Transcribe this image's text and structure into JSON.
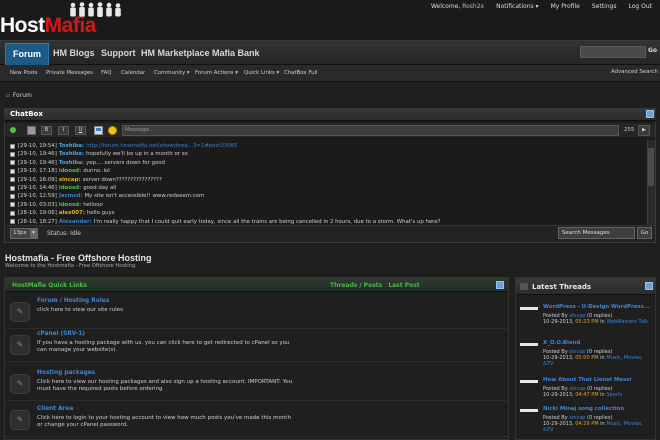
{
  "header": {
    "logo_part1": "Host",
    "logo_part2": "Mafia",
    "welcome": "Welcome,",
    "username": "Rosh2x",
    "notifications": "Notifications ▾",
    "my_profile": "My Profile",
    "settings": "Settings",
    "logout": "Log Out"
  },
  "nav": {
    "tabs": [
      "Forum",
      "HM Blogs",
      "Support",
      "HM Marketplace",
      "Mafia Bank"
    ],
    "go": "Go"
  },
  "subnav": {
    "items": [
      "New Posts",
      "Private Messages",
      "FAQ",
      "Calendar",
      "Community ▾",
      "Forum Actions ▾",
      "Quick Links ▾",
      "ChatBox Full"
    ],
    "advanced_search": "Advanced Search"
  },
  "breadcrumb": "Forum",
  "chatbox": {
    "title": "ChatBox",
    "toolbar_buttons": [
      "B",
      "I",
      "U"
    ],
    "input_placeholder": "Message...",
    "char_count": "255",
    "send": "▶",
    "messages": [
      {
        "time": "[29-10, 19:54]",
        "user": "Toshiba:",
        "user_color": "#4aa8e0",
        "text": "http://forum.hostmafia.net/showthrea...3=1#post23085",
        "link": true
      },
      {
        "time": "[29-10, 19:46]",
        "user": "Toshiba:",
        "user_color": "#4aa8e0",
        "text": "hopefully we'll be up in a month or so",
        "link": false
      },
      {
        "time": "[29-10, 19:46]",
        "user": "Toshiba:",
        "user_color": "#4aa8e0",
        "text": "yep.... servers down for good",
        "link": false
      },
      {
        "time": "[29-10, 17:18]",
        "user": "idoosd:",
        "user_color": "#4fc14f",
        "text": "dunno..lol",
        "link": false
      },
      {
        "time": "[29-10, 16:09]",
        "user": "sincap:",
        "user_color": "#e0b020",
        "text": "server down????????????????",
        "link": false
      },
      {
        "time": "[29-10, 14:46]",
        "user": "idoosd:",
        "user_color": "#4fc14f",
        "text": "good day all",
        "link": false
      },
      {
        "time": "[29-10, 12:59]",
        "user": "Jacmsd:",
        "user_color": "#3f7dc6",
        "text": "My site isn't accessible!! www.redeeem.com",
        "link": false
      },
      {
        "time": "[29-10, 03:03]",
        "user": "idoosd:",
        "user_color": "#4fc14f",
        "text": "hellooo",
        "link": false
      },
      {
        "time": "[28-10, 19:06]",
        "user": "alex007:",
        "user_color": "#e0b020",
        "text": "hello guys",
        "link": false
      },
      {
        "time": "[28-10, 18:27]",
        "user": "Alexander:",
        "user_color": "#3f7dc6",
        "text": "I'm really happy that I could quit early today, since all the trains are being cancelled in 2 hours, due to a storm. What's up here?",
        "link": false
      }
    ],
    "font_size": "13px",
    "status_label": "Status:",
    "status_value": "Idle",
    "search_messages": "Search Messages",
    "search_go": "Go"
  },
  "forum": {
    "title": "Hostmafia - Free Offshore Hosting",
    "subtitle": "Welcome to the Hostmafia - Free Offshore Hosting."
  },
  "quick_links": {
    "title": "HostMafia Quick Links",
    "col_threads": "Threads / Posts",
    "col_last": "Last Post",
    "rows": [
      {
        "name": "Forum / Hosting Rules",
        "desc": "click here to view our site rules"
      },
      {
        "name": "cPanel (SRV-1)",
        "desc": "If you have a hosting package with us, you can click here to get redirected to cPanel so you can manage your website(s)."
      },
      {
        "name": "Hosting packages",
        "desc": "Click here to view our hosting packages and also sign up a hosting account. IMPORTANT: You must have the required posts before ordering"
      },
      {
        "name": "Client Area",
        "desc": "Click here to login to your hosting account to view how much posts you've made this month or change your cPanel password."
      }
    ]
  },
  "latest_threads": {
    "title": "Latest Threads",
    "items": [
      {
        "name": "WordPress - U-Design WordPress...",
        "posted_by": "Posted By",
        "user": "sincap",
        "replies": "(0 replies)",
        "date": "10-29-2013,",
        "time": "05:23 PM",
        "in": "in",
        "forum": "WebMasters Talk"
      },
      {
        "name": "X_O.O.Blend",
        "posted_by": "Posted By",
        "user": "sincap",
        "replies": "(0 replies)",
        "date": "10-29-2013,",
        "time": "05:00 PM",
        "in": "in",
        "forum": "Music, Movies, &TV"
      },
      {
        "name": "How About That Lionel Messi",
        "posted_by": "Posted By",
        "user": "sincap",
        "replies": "(0 replies)",
        "date": "10-29-2013,",
        "time": "04:47 PM",
        "in": "in",
        "forum": "Sports"
      },
      {
        "name": "Nicki Minaj song collection",
        "posted_by": "Posted By",
        "user": "sincap",
        "replies": "(0 replies)",
        "date": "10-29-2013,",
        "time": "04:29 PM",
        "in": "in",
        "forum": "Music, Movies, &TV"
      }
    ]
  }
}
